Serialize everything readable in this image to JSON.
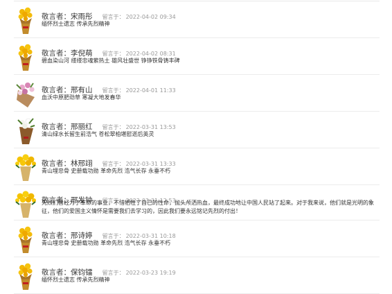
{
  "labels": {
    "by": "敬言者：",
    "time_prefix": "留言于："
  },
  "messages": [
    {
      "name": "宋雨彤",
      "time": "2022-04-02 09:34",
      "text": "缅怀烈士遗志 传承先烈精神",
      "flower": "yellow-bouquet-icon"
    },
    {
      "name": "李倪萌",
      "time": "2022-04-02 08:31",
      "text": "碧血染山河 缕缕忠魂萦热土 雄风壮盛世 铮铮铁骨铸丰碑",
      "flower": "yellow-bouquet-icon"
    },
    {
      "name": "邢有山",
      "time": "2022-04-01 11:33",
      "text": "血沃中原肥劲草 寒凝大地发春华",
      "flower": "pink-bouquet-icon"
    },
    {
      "name": "邢丽红",
      "time": "2022-03-31 13:53",
      "text": "清山绿水长留生前浩气 苍松翠柏堪慰逝后英灵",
      "flower": "white-lily-bouquet-icon"
    },
    {
      "name": "林邢翊",
      "time": "2022-03-31 13:33",
      "text": "青山埋忠骨 史册载功勋 革命先烈 浩气长存 永垂不朽",
      "flower": "yellow-chrysanthemum-icon"
    },
    {
      "name": "邢发钟",
      "time": "2022-03-31 12:53",
      "text": "先烈们曾经为了革命的事业，不惜牺牲了自己的性命，抛头颅洒热血，最终成功地让中国人民站了起来。对于我来说，他们就是光明的象征，他们的爱国主义情怀是需要我们去学习的，因此我们要永远铭记先烈的付出！",
      "flower": "yellow-chrysanthemum-icon"
    },
    {
      "name": "邢诗婷",
      "time": "2022-03-31 10:18",
      "text": "青山埋忠骨 史册载功勋 革命先烈 浩气长存 永垂不朽",
      "flower": "yellow-bouquet-icon"
    },
    {
      "name": "保钧镭",
      "time": "2022-03-23 19:19",
      "text": "缅怀烈士遗志 传承先烈精神",
      "flower": "yellow-bouquet-icon"
    }
  ]
}
